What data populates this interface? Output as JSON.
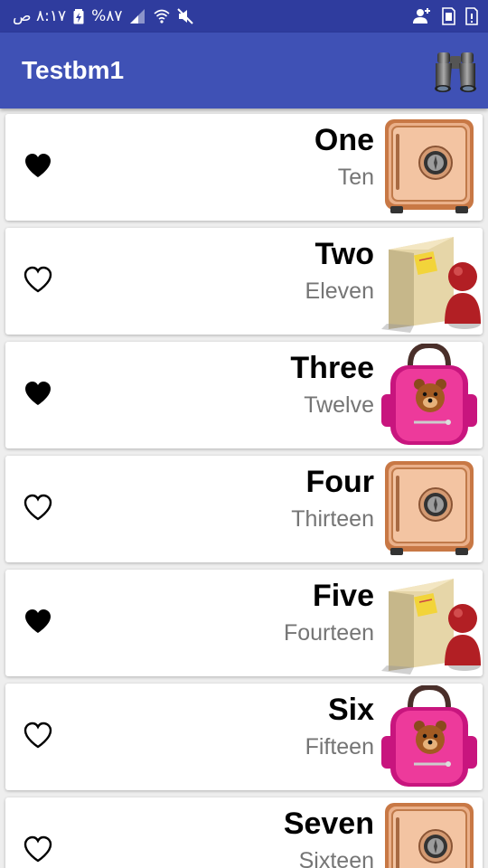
{
  "status_bar": {
    "time": "٨:١٧ ص",
    "battery": "%٨٧"
  },
  "app_bar": {
    "title": "Testbm1",
    "action_icon": "binoculars-icon"
  },
  "items": [
    {
      "title": "One",
      "subtitle": "Ten",
      "favorite": true,
      "image": "safe-icon"
    },
    {
      "title": "Two",
      "subtitle": "Eleven",
      "favorite": false,
      "image": "user-folder-icon"
    },
    {
      "title": "Three",
      "subtitle": "Twelve",
      "favorite": true,
      "image": "backpack-icon"
    },
    {
      "title": "Four",
      "subtitle": "Thirteen",
      "favorite": false,
      "image": "safe-icon"
    },
    {
      "title": "Five",
      "subtitle": "Fourteen",
      "favorite": true,
      "image": "user-folder-icon"
    },
    {
      "title": "Six",
      "subtitle": "Fifteen",
      "favorite": false,
      "image": "backpack-icon"
    },
    {
      "title": "Seven",
      "subtitle": "Sixteen",
      "favorite": false,
      "image": "safe-icon"
    }
  ],
  "colors": {
    "status_bar": "#2f3c9e",
    "app_bar": "#3f51b5",
    "subtitle_text": "#757575"
  }
}
